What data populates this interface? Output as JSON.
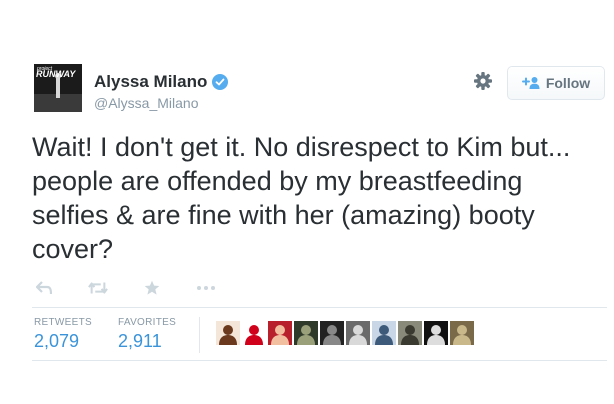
{
  "user": {
    "name": "Alyssa Milano",
    "handle": "@Alyssa_Milano",
    "avatar_text_top": "project",
    "avatar_text_main": "RUNWAY"
  },
  "follow_button": {
    "label": "Follow"
  },
  "tweet": {
    "text": "Wait! I don't get it. No disrespect to Kim but... people are offended by my breastfeeding selfies & are fine with her (amazing) booty cover?"
  },
  "actions": [
    "reply-icon",
    "retweet-icon",
    "favorite-icon",
    "more-icon"
  ],
  "stats": {
    "retweets_label": "RETWEETS",
    "retweets_value": "2,079",
    "favorites_label": "FAVORITES",
    "favorites_value": "2,911"
  },
  "favoriters": [
    {
      "bg": "#f4e7d9",
      "fg": "#6b3a1e"
    },
    {
      "bg": "#ffffff",
      "fg": "#d0021b"
    },
    {
      "bg": "#b8202c",
      "fg": "#f2c0a0"
    },
    {
      "bg": "#2f3a2a",
      "fg": "#9aa07a"
    },
    {
      "bg": "#222222",
      "fg": "#888888"
    },
    {
      "bg": "#6a6a6a",
      "fg": "#d9d9d9"
    },
    {
      "bg": "#c9d6e6",
      "fg": "#3d5a7a"
    },
    {
      "bg": "#8a8a7a",
      "fg": "#3a3a30"
    },
    {
      "bg": "#111111",
      "fg": "#dddddd"
    },
    {
      "bg": "#7a6a4a",
      "fg": "#c9b88a"
    }
  ],
  "colors": {
    "link": "#3b94d9",
    "muted": "#8899a6",
    "verified": "#55acee",
    "text": "#292f33"
  }
}
